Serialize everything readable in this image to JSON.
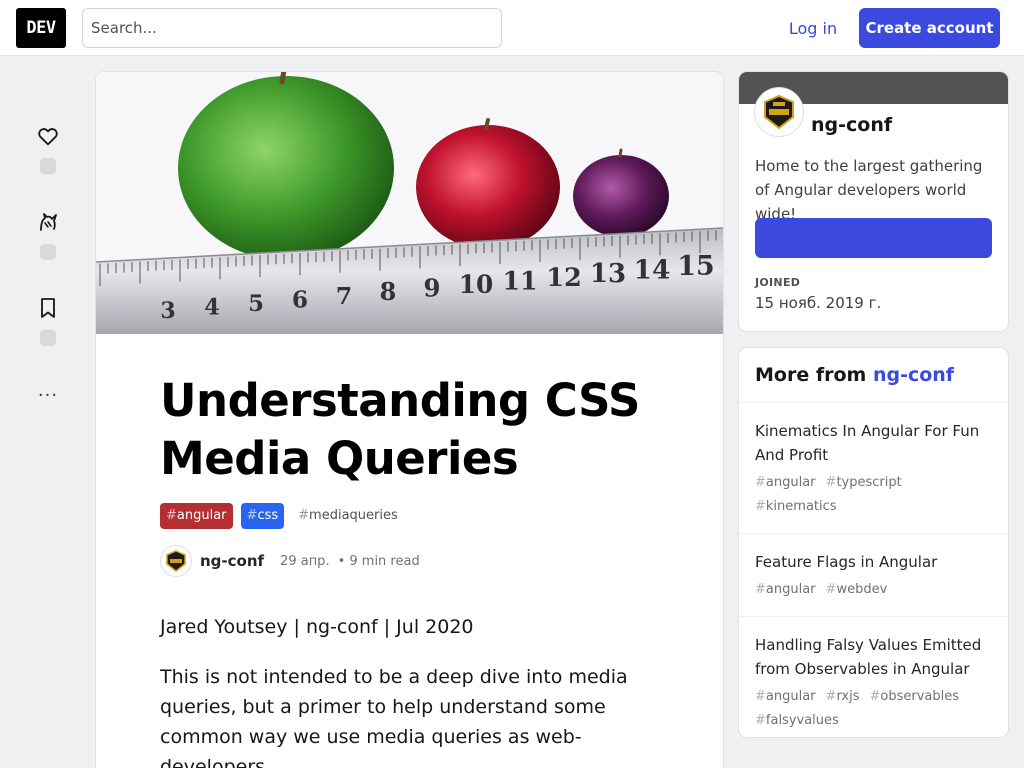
{
  "header": {
    "logo_text": "DEV",
    "search_placeholder": "Search...",
    "login_label": "Log in",
    "create_account_label": "Create account"
  },
  "reactions": {
    "heart_icon": "heart-icon",
    "unicorn_icon": "unicorn-icon",
    "bookmark_icon": "bookmark-icon",
    "more_label": "..."
  },
  "article": {
    "title": "Understanding CSS Media Queries",
    "tags": [
      {
        "hash": "#",
        "name": "angular",
        "color": "#b52e31"
      },
      {
        "hash": "#",
        "name": "css",
        "color": "#2965f1"
      },
      {
        "hash": "#",
        "name": "mediaqueries",
        "color": ""
      }
    ],
    "author": "ng-conf",
    "date": "29 апр.",
    "read_time": "• 9 min read",
    "paragraphs": [
      "Jared Youtsey | ng-conf | Jul 2020",
      "This is not intended to be a deep dive into media queries, but a primer to help understand some common way we use media queries as web-developers."
    ]
  },
  "org": {
    "name": "ng-conf",
    "description": "Home to the largest gathering of Angular developers world wide!",
    "follow_label": "",
    "joined_label": "JOINED",
    "joined_value": "15 нояб. 2019 г."
  },
  "more_from": {
    "prefix": "More from",
    "org": "ng-conf",
    "items": [
      {
        "title": "Kinematics In Angular For Fun And Profit",
        "tags": [
          "angular",
          "typescript",
          "kinematics"
        ]
      },
      {
        "title": "Feature Flags in Angular",
        "tags": [
          "angular",
          "webdev"
        ]
      },
      {
        "title": "Handling Falsy Values Emitted from Observables in Angular",
        "tags": [
          "angular",
          "rxjs",
          "observables",
          "falsyvalues"
        ]
      }
    ]
  },
  "cover_image": {
    "ruler_numbers": [
      "3",
      "4",
      "5",
      "6",
      "7",
      "8",
      "9",
      "10",
      "11",
      "12",
      "13",
      "14",
      "15"
    ]
  },
  "colors": {
    "accent": "#3b49df",
    "org_band": "#555351"
  }
}
